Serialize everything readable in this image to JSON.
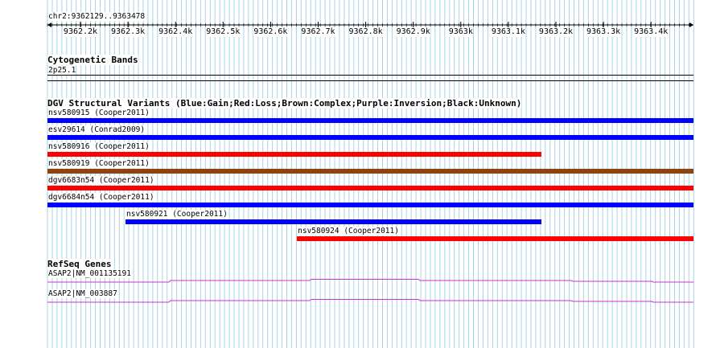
{
  "coordinates": {
    "label": "chr2:9362129..9363478"
  },
  "ruler": {
    "ticks": [
      "9362.2k",
      "9362.3k",
      "9362.4k",
      "9362.5k",
      "9362.6k",
      "9362.7k",
      "9362.8k",
      "9362.9k",
      "9363k",
      "9363.1k",
      "9363.2k",
      "9363.3k",
      "9363.4k"
    ],
    "range": [
      9362129,
      9363478
    ]
  },
  "cytobands": {
    "title": "Cytogenetic Bands",
    "band": "2p25.1"
  },
  "dgv": {
    "title": "DGV Structural Variants (Blue:Gain;Red:Loss;Brown:Complex;Purple:Inversion;Black:Unknown)",
    "variants": [
      {
        "label": "nsv580915 (Cooper2011)",
        "type": "Gain",
        "color": "#0000ff",
        "start": 9362129,
        "end": 9363478
      },
      {
        "label": "esv29614 (Conrad2009)",
        "type": "Gain",
        "color": "#0000ff",
        "start": 9362129,
        "end": 9363478
      },
      {
        "label": "nsv580916 (Cooper2011)",
        "type": "Loss",
        "color": "#ff0000",
        "start": 9362129,
        "end": 9363160
      },
      {
        "label": "nsv580919 (Cooper2011)",
        "type": "Complex",
        "color": "#8b4513",
        "start": 9362129,
        "end": 9363478
      },
      {
        "label": "dgv6683n54 (Cooper2011)",
        "type": "Loss",
        "color": "#ff0000",
        "start": 9362129,
        "end": 9363478
      },
      {
        "label": "dgv6684n54 (Cooper2011)",
        "type": "Gain",
        "color": "#0000ff",
        "start": 9362129,
        "end": 9363478
      },
      {
        "label": "nsv580921 (Cooper2011)",
        "type": "Gain",
        "color": "#0000ff",
        "start": 9362292,
        "end": 9363160
      },
      {
        "label": "nsv580924 (Cooper2011)",
        "type": "Loss",
        "color": "#ff0000",
        "start": 9362650,
        "end": 9363478
      }
    ]
  },
  "refseq": {
    "title": "RefSeq Genes",
    "genes": [
      {
        "label": "ASAP2|NM_001135191",
        "color": "#cc33cc"
      },
      {
        "label": "ASAP2|NM_003887",
        "color": "#cc33cc"
      }
    ]
  }
}
